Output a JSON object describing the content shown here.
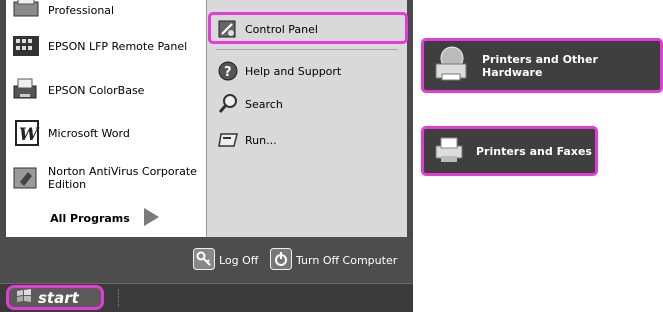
{
  "left_programs": [
    {
      "label": "Professional",
      "icon": "printer-icon"
    },
    {
      "label": "EPSON LFP Remote Panel",
      "icon": "remote-panel-icon"
    },
    {
      "label": "EPSON ColorBase",
      "icon": "colorbase-icon"
    },
    {
      "label": "Microsoft Word",
      "icon": "word-icon"
    },
    {
      "label": "Norton AntiVirus Corporate Edition",
      "icon": "antivirus-icon"
    }
  ],
  "all_programs": "All Programs",
  "right_items": {
    "control_panel": "Control Panel",
    "help": "Help and Support",
    "search": "Search",
    "run": "Run..."
  },
  "bottom": {
    "log_off": "Log Off",
    "turn_off": "Turn Off Computer"
  },
  "taskbar": {
    "start": "start"
  },
  "callouts": {
    "printers_hardware": "Printers and Other Hardware",
    "printers_faxes": "Printers and Faxes"
  },
  "colors": {
    "highlight": "#e43ad8",
    "menu_dark": "#4a4a4a",
    "right_pane": "#d9d9d9"
  }
}
